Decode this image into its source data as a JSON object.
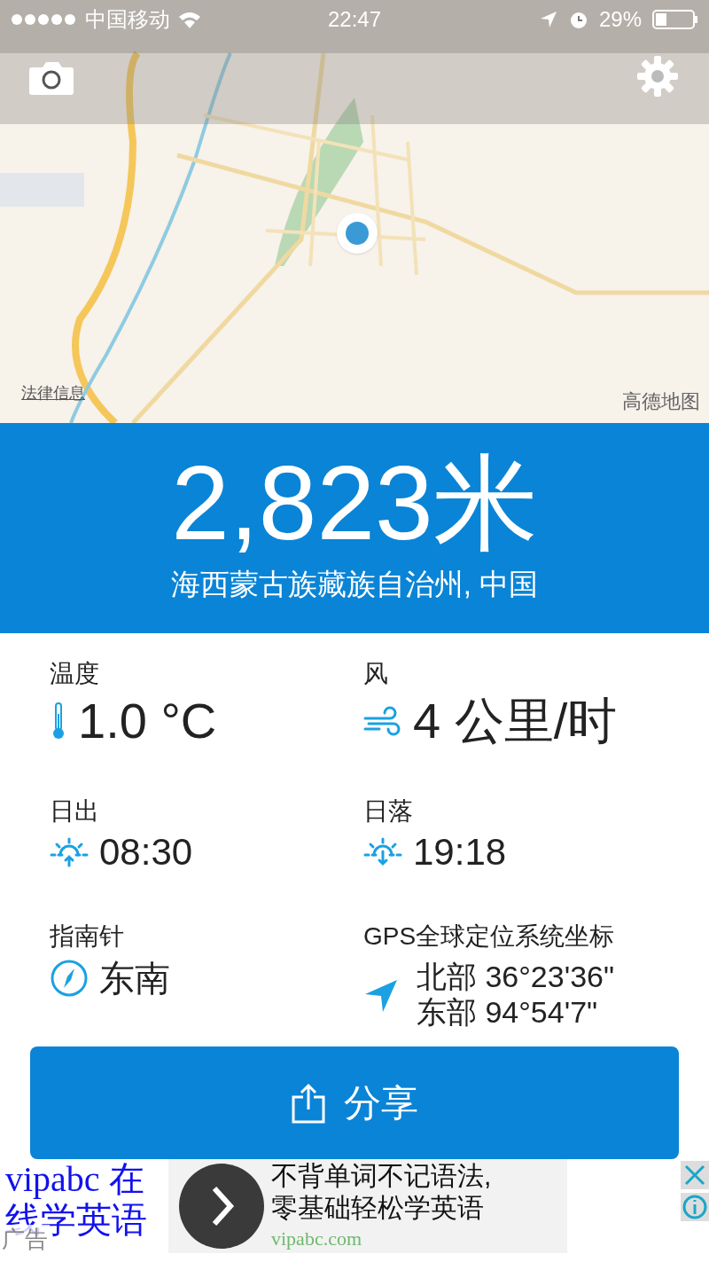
{
  "status_bar": {
    "carrier": "中国移动",
    "time": "22:47",
    "battery": "29%"
  },
  "map": {
    "legal_link": "法律信息",
    "attribution": "高德地图"
  },
  "altitude": {
    "value": "2,823米",
    "region": "海西蒙古族藏族自治州, 中国"
  },
  "stats": [
    {
      "kind": "temperature",
      "label": "温度",
      "value": "1.0 °C"
    },
    {
      "kind": "wind",
      "label": "风",
      "value": "4 公里/时"
    },
    {
      "kind": "sunrise",
      "label": "日出",
      "value": "08:30"
    },
    {
      "kind": "sunset",
      "label": "日落",
      "value": "19:18"
    },
    {
      "kind": "compass",
      "label": "指南针",
      "value": "东南"
    },
    {
      "kind": "gps",
      "label": "GPS全球定位系统坐标",
      "lines": [
        "北部 36°23'36\"",
        "东部 94°54'7\""
      ]
    }
  ],
  "share_button": {
    "label": "分享"
  },
  "ad": {
    "headline": "vipabc 在线学英语",
    "tag": "广告",
    "lines": [
      "不背单词不记语法,",
      "零基础轻松学英语"
    ],
    "url": "vipabc.com"
  }
}
